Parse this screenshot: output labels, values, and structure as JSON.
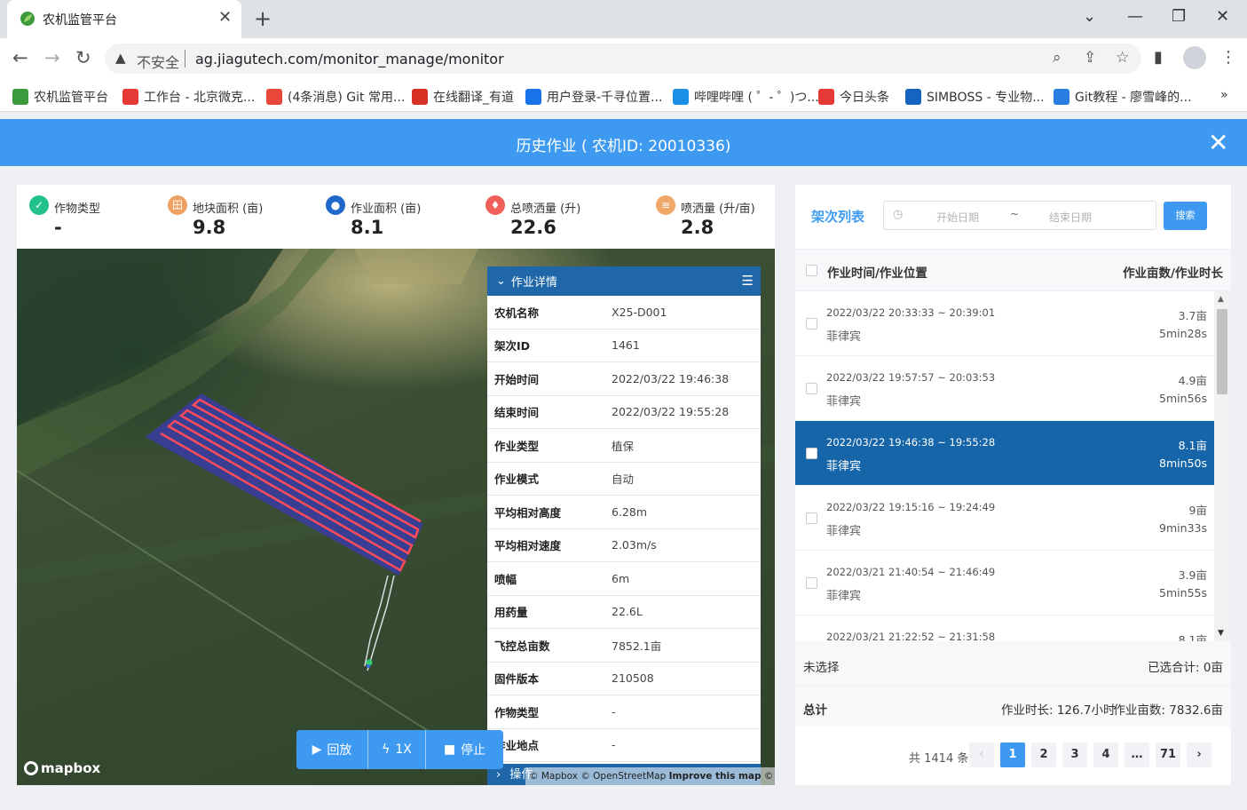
{
  "browser": {
    "tab_title": "农机监管平台",
    "tab_close": "✕",
    "new_tab": "+",
    "insecure_label": "不安全",
    "url": "ag.jiagutech.com/monitor_manage/monitor",
    "bookmarks": [
      {
        "label": "农机监管平台",
        "icon": "leaf-icon",
        "color": "#3c9a3c"
      },
      {
        "label": "工作台 - 北京微克...",
        "icon": "g-icon",
        "color": "#e53935"
      },
      {
        "label": "(4条消息) Git 常用...",
        "icon": "c-icon",
        "color": "#e8473a"
      },
      {
        "label": "在线翻译_有道",
        "icon": "y-icon",
        "color": "#d93025"
      },
      {
        "label": "用户登录-千寻位置...",
        "icon": "q-icon",
        "color": "#1a73e8"
      },
      {
        "label": "哔哩哔哩 ( ゜- ゜)つ...",
        "icon": "tv-icon",
        "color": "#1a8fe3"
      },
      {
        "label": "今日头条",
        "icon": "toutiao-icon",
        "color": "#e53935"
      },
      {
        "label": "SIMBOSS - 专业物...",
        "icon": "sim-icon",
        "color": "#1565c0"
      },
      {
        "label": "Git教程 - 廖雪峰的...",
        "icon": "rocket-icon",
        "color": "#2a7de1"
      }
    ],
    "more_bookmarks": "»"
  },
  "header": {
    "title": "历史作业 ( 农机ID: 20010336)",
    "close": "✕"
  },
  "stats": [
    {
      "label": "作物类型",
      "value": "-",
      "color": "#22c08a",
      "icon": "check-icon"
    },
    {
      "label": "地块面积 (亩)",
      "value": "9.8",
      "color": "#f0a060",
      "icon": "field-icon"
    },
    {
      "label": "作业面积 (亩)",
      "value": "8.1",
      "color": "#1f67c8",
      "icon": "location-icon"
    },
    {
      "label": "总喷洒量 (升)",
      "value": "22.6",
      "color": "#f0605a",
      "icon": "drop-icon"
    },
    {
      "label": "喷洒量 (升/亩)",
      "value": "2.8",
      "color": "#f0a868",
      "icon": "spray-icon"
    }
  ],
  "detail": {
    "title": "作业详情",
    "rows": [
      {
        "k": "农机名称",
        "v": "X25-D001"
      },
      {
        "k": "架次ID",
        "v": "1461"
      },
      {
        "k": "开始时间",
        "v": "2022/03/22 19:46:38"
      },
      {
        "k": "结束时间",
        "v": "2022/03/22 19:55:28"
      },
      {
        "k": "作业类型",
        "v": "植保"
      },
      {
        "k": "作业模式",
        "v": "自动"
      },
      {
        "k": "平均相对高度",
        "v": "6.28m"
      },
      {
        "k": "平均相对速度",
        "v": "2.03m/s"
      },
      {
        "k": "喷幅",
        "v": "6m"
      },
      {
        "k": "用药量",
        "v": "22.6L"
      },
      {
        "k": "飞控总亩数",
        "v": "7852.1亩"
      },
      {
        "k": "固件版本",
        "v": "210508"
      },
      {
        "k": "作物类型",
        "v": "-"
      },
      {
        "k": "作业地点",
        "v": "-"
      }
    ],
    "footer": "操作"
  },
  "map": {
    "logo": "mapbox",
    "attribution_prefix": "© Mapbox © OpenStreetMap",
    "attribution_improve": "Improve this map",
    "attribution_suffix": "© Maxar"
  },
  "playback": {
    "replay": "回放",
    "speed": "1X",
    "stop": "停止"
  },
  "flight_list": {
    "title": "架次列表",
    "start_placeholder": "开始日期",
    "range_sep": "~",
    "end_placeholder": "结束日期",
    "search": "搜索",
    "header_left": "作业时间/作业位置",
    "header_right": "作业亩数/作业时长",
    "rows": [
      {
        "time": "2022/03/22 20:33:33 ~ 20:39:01",
        "loc": "菲律宾",
        "area": "3.7亩",
        "dur": "5min28s",
        "selected": false
      },
      {
        "time": "2022/03/22 19:57:57 ~ 20:03:53",
        "loc": "菲律宾",
        "area": "4.9亩",
        "dur": "5min56s",
        "selected": false
      },
      {
        "time": "2022/03/22 19:46:38 ~ 19:55:28",
        "loc": "菲律宾",
        "area": "8.1亩",
        "dur": "8min50s",
        "selected": true
      },
      {
        "time": "2022/03/22 19:15:16 ~ 19:24:49",
        "loc": "菲律宾",
        "area": "9亩",
        "dur": "9min33s",
        "selected": false
      },
      {
        "time": "2022/03/21 21:40:54 ~ 21:46:49",
        "loc": "菲律宾",
        "area": "3.9亩",
        "dur": "5min55s",
        "selected": false
      },
      {
        "time": "2022/03/21 21:22:52 ~ 21:31:58",
        "loc": "",
        "area": "8.1亩",
        "dur": "",
        "selected": false
      }
    ],
    "unselected": "未选择",
    "selected_total": "已选合计: 0亩",
    "total_label": "总计",
    "total_duration": "作业时长: 126.7小时",
    "total_area": "作业亩数: 7832.6亩",
    "pager": {
      "total": "共 1414 条",
      "prev": "‹",
      "pages": [
        "1",
        "2",
        "3",
        "4",
        "…",
        "71"
      ],
      "next": "›",
      "active": "1"
    }
  }
}
